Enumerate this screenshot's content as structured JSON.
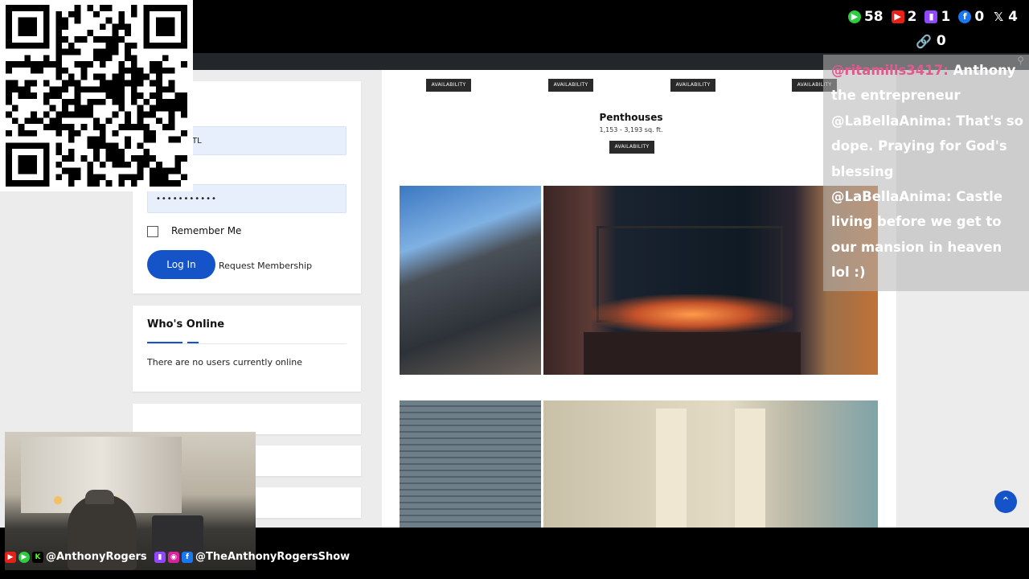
{
  "stream_stats": {
    "views": "58",
    "youtube": "2",
    "twitch": "1",
    "facebook": "0",
    "x": "4",
    "link": "0"
  },
  "chat": {
    "messages": [
      {
        "user": "@ritamills3417:",
        "text": "Anthony the entrepreneur"
      },
      {
        "user": "@LaBellaAnima:",
        "text": "That's so dope. Praying for God's blessing"
      },
      {
        "user": "@LaBellaAnima:",
        "text": "Castle living before we get to our mansion in heaven lol :)"
      }
    ]
  },
  "login": {
    "username_value": "TL",
    "password_value": "•••••••••••",
    "remember_label": "Remember Me",
    "login_button": "Log In",
    "request_link": "Request Membership"
  },
  "whos_online": {
    "title": "Who's Online",
    "text": "There are no users currently online"
  },
  "floorplans": {
    "availability_label": "AVAILABILITY",
    "penthouses_title": "Penthouses",
    "penthouses_range": "1,153 - 3,193 sq. ft."
  },
  "social": {
    "left_handle": "@AnthonyRogers",
    "right_handle": "@TheAnthonyRogersShow"
  },
  "colors": {
    "accent": "#1553c9",
    "chat_user_pink": "#e05a8e",
    "views_green": "#2ecc40",
    "youtube_red": "#e62117",
    "twitch_purple": "#9146ff",
    "facebook_blue": "#1877f2"
  }
}
